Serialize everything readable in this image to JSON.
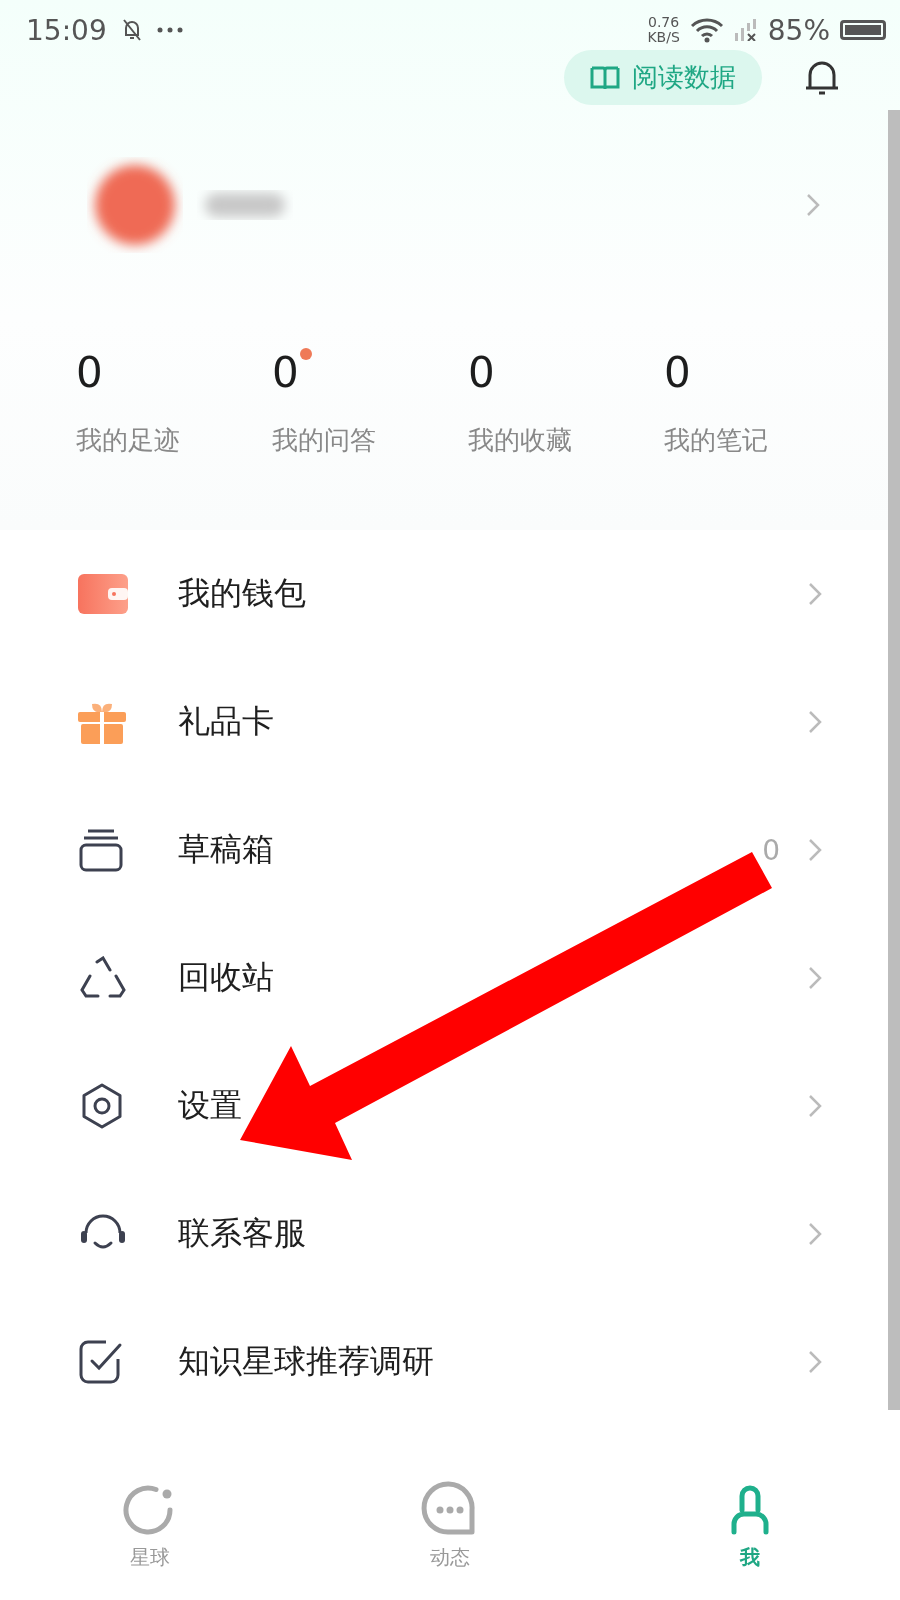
{
  "status_bar": {
    "time": "15:09",
    "speed_value": "0.76",
    "speed_unit": "KB/S",
    "battery": "85%"
  },
  "header": {
    "button": "阅读数据"
  },
  "stats": [
    {
      "value": "0",
      "label": "我的足迹",
      "has_new": false
    },
    {
      "value": "0",
      "label": "我的问答",
      "has_new": true
    },
    {
      "value": "0",
      "label": "我的收藏",
      "has_new": false
    },
    {
      "value": "0",
      "label": "我的笔记",
      "has_new": false
    }
  ],
  "menu": [
    {
      "kind": "wallet",
      "label": "我的钱包"
    },
    {
      "kind": "gift",
      "label": "礼品卡"
    },
    {
      "kind": "drafts",
      "label": "草稿箱",
      "count": "0"
    },
    {
      "kind": "recycle",
      "label": "回收站"
    },
    {
      "kind": "settings",
      "label": "设置"
    },
    {
      "kind": "support",
      "label": "联系客服"
    },
    {
      "kind": "survey",
      "label": "知识星球推荐调研"
    }
  ],
  "tabs": [
    {
      "kind": "planet",
      "label": "星球",
      "selected": false
    },
    {
      "kind": "chat",
      "label": "动态",
      "selected": false
    },
    {
      "kind": "me",
      "label": "我",
      "selected": true
    }
  ]
}
